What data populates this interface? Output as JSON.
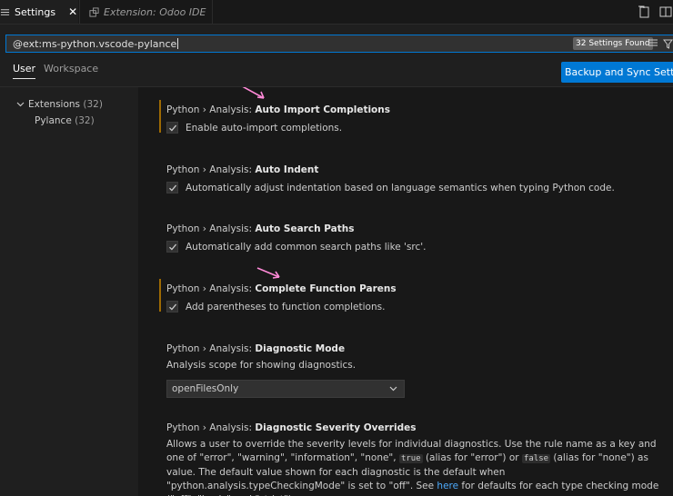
{
  "tabs": {
    "active": {
      "label": "Settings",
      "close": "✕"
    },
    "inactive": {
      "label": "Extension: Odoo IDE"
    }
  },
  "search": {
    "query": "@ext:ms-python.vscode-pylance",
    "results": "32 Settings Found"
  },
  "scopes": {
    "user": "User",
    "workspace": "Workspace"
  },
  "sync_button": "Backup and Sync Settings",
  "toc": {
    "extensions": {
      "label": "Extensions",
      "count": "(32)"
    },
    "pylance": {
      "label": "Pylance",
      "count": "(32)"
    }
  },
  "settings": [
    {
      "prefix": "Python › Analysis: ",
      "name": "Auto Import Completions",
      "desc": "Enable auto-import completions."
    },
    {
      "prefix": "Python › Analysis: ",
      "name": "Auto Indent",
      "desc": "Automatically adjust indentation based on language semantics when typing Python code."
    },
    {
      "prefix": "Python › Analysis: ",
      "name": "Auto Search Paths",
      "desc": "Automatically add common search paths like 'src'."
    },
    {
      "prefix": "Python › Analysis: ",
      "name": "Complete Function Parens",
      "desc": "Add parentheses to function completions."
    },
    {
      "prefix": "Python › Analysis: ",
      "name": "Diagnostic Mode",
      "desc": "Analysis scope for showing diagnostics.",
      "value": "openFilesOnly"
    },
    {
      "prefix": "Python › Analysis: ",
      "name": "Diagnostic Severity Overrides",
      "desc_parts": {
        "a": "Allows a user to override the severity levels for individual diagnostics. Use the rule name as a key and one of \"error\", \"warning\", \"information\", \"none\", ",
        "code_true": "true",
        "b": " (alias for \"error\") or ",
        "code_false": "false",
        "c": " (alias for \"none\") as value. The default value shown for each diagnostic is the default when \"python.analysis.typeCheckingMode\" is set to \"off\". See ",
        "link": "here",
        "d": " for defaults for each type checking mode (\"off\", \"basic\" and \"strict\")."
      }
    }
  ],
  "colors": {
    "accent": "#0078d4",
    "modified_marker": "#9e6a03",
    "annotation_arrow": "#ff8ad8"
  }
}
